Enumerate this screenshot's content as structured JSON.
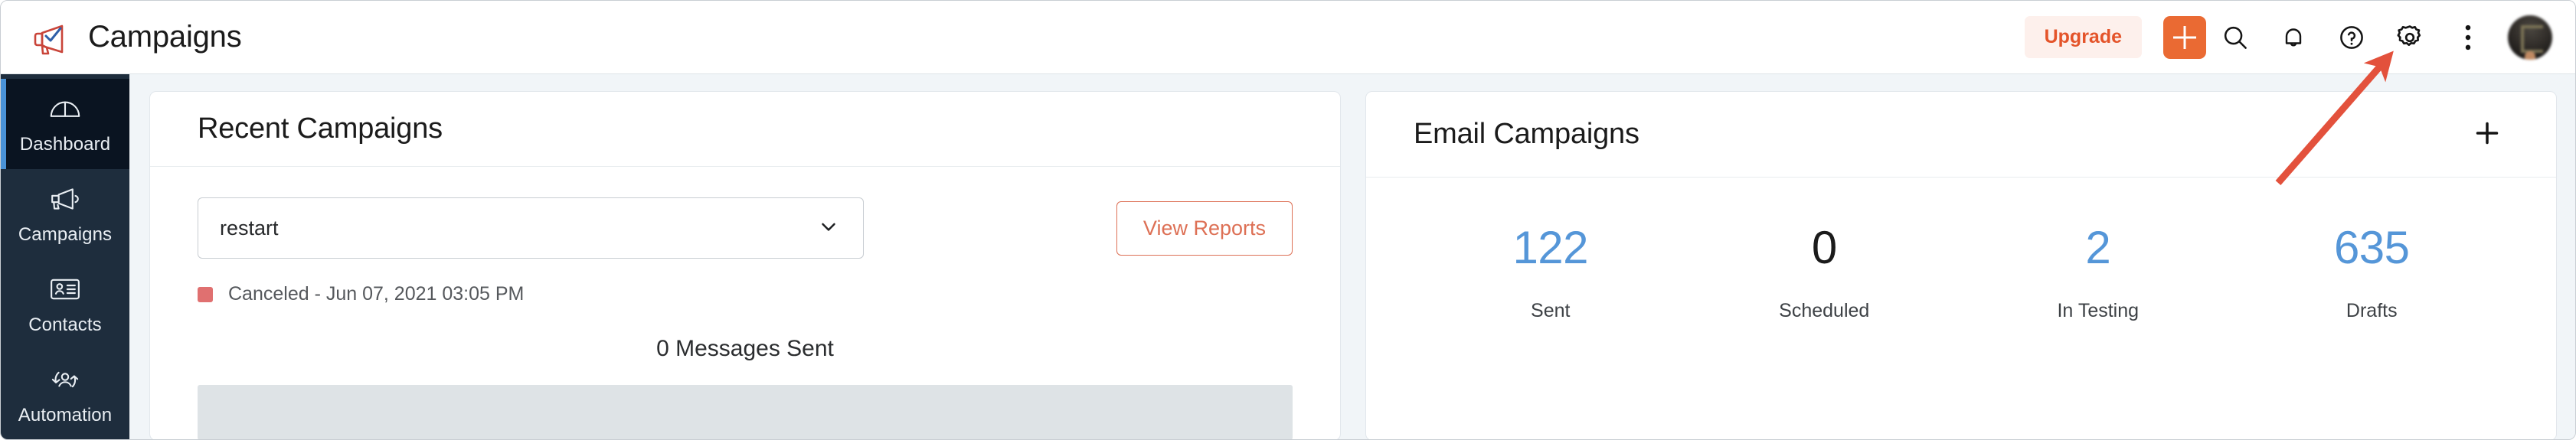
{
  "header": {
    "brand_title": "Campaigns",
    "logo_icon": "megaphone-check-logo",
    "upgrade_label": "Upgrade",
    "add_icon": "plus-icon",
    "search_icon": "search-icon",
    "notifications_icon": "bell-icon",
    "help_icon": "question-circle-icon",
    "settings_icon": "gear-icon",
    "more_icon": "three-dots-vertical-icon",
    "avatar_icon": "user-avatar"
  },
  "sidebar": {
    "items": [
      {
        "label": "Dashboard",
        "icon": "gauge-icon",
        "active": true
      },
      {
        "label": "Campaigns",
        "icon": "megaphone-icon",
        "active": false
      },
      {
        "label": "Contacts",
        "icon": "contact-card-icon",
        "active": false
      },
      {
        "label": "Automation",
        "icon": "automation-icon",
        "active": false
      }
    ]
  },
  "recent_campaigns": {
    "title": "Recent Campaigns",
    "selected_campaign": "restart",
    "dropdown_icon": "chevron-down-icon",
    "view_reports_label": "View Reports",
    "status_text": "Canceled - Jun 07, 2021 03:05 PM",
    "status_color": "#e07070",
    "messages_sent_label": "0 Messages Sent",
    "progress_percent": 0
  },
  "email_campaigns": {
    "title": "Email Campaigns",
    "add_icon": "plus-icon",
    "stats": [
      {
        "value": "122",
        "label": "Sent",
        "color": "#5596d8"
      },
      {
        "value": "0",
        "label": "Scheduled",
        "color": "#1b1b1b"
      },
      {
        "value": "2",
        "label": "In Testing",
        "color": "#5596d8"
      },
      {
        "value": "635",
        "label": "Drafts",
        "color": "#5596d8"
      }
    ]
  },
  "annotation": {
    "arrow_color": "#e3513c",
    "points_to": "gear-icon"
  },
  "colors": {
    "accent_orange": "#ea6a33",
    "accent_blue": "#5596d8",
    "sidebar_bg": "#1e2d3d",
    "page_bg": "#f1f5f8"
  }
}
